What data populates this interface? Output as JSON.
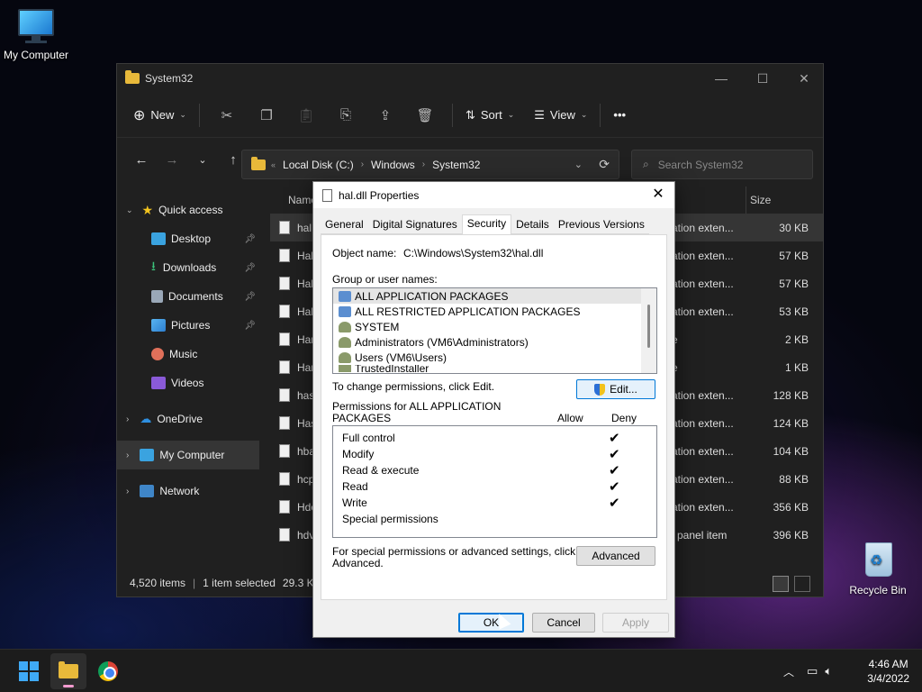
{
  "desktop": {
    "icons": [
      {
        "label": "My Computer"
      },
      {
        "label": "Recycle Bin"
      }
    ]
  },
  "explorer": {
    "title": "System32",
    "toolbar": {
      "new_label": "New",
      "sort_label": "Sort",
      "view_label": "View",
      "more_label": "•••"
    },
    "address": {
      "crumbs": [
        "Local Disk (C:)",
        "Windows",
        "System32"
      ],
      "search_placeholder": "Search System32"
    },
    "sidebar": {
      "items": [
        {
          "label": "Quick access"
        },
        {
          "label": "Desktop"
        },
        {
          "label": "Downloads"
        },
        {
          "label": "Documents"
        },
        {
          "label": "Pictures"
        },
        {
          "label": "Music"
        },
        {
          "label": "Videos"
        },
        {
          "label": "OneDrive"
        },
        {
          "label": "My Computer"
        },
        {
          "label": "Network"
        }
      ]
    },
    "columns": {
      "name": "Name",
      "size": "Size"
    },
    "files": [
      {
        "name": "hal.",
        "type": "ation exten...",
        "size": "30 KB"
      },
      {
        "name": "Hal",
        "type": "ation exten...",
        "size": "57 KB"
      },
      {
        "name": "Hal",
        "type": "ation exten...",
        "size": "57 KB"
      },
      {
        "name": "Hal",
        "type": "ation exten...",
        "size": "53 KB"
      },
      {
        "name": "Han",
        "type": "e",
        "size": "2 KB"
      },
      {
        "name": "Han",
        "type": "e",
        "size": "1 KB"
      },
      {
        "name": "has",
        "type": "ation exten...",
        "size": "128 KB"
      },
      {
        "name": "Has",
        "type": "ation exten...",
        "size": "124 KB"
      },
      {
        "name": "hba",
        "type": "ation exten...",
        "size": "104 KB"
      },
      {
        "name": "hcp",
        "type": "ation exten...",
        "size": "88 KB"
      },
      {
        "name": "Hdc",
        "type": "ation exten...",
        "size": "356 KB"
      },
      {
        "name": "hdv",
        "type": "l panel item",
        "size": "396 KB"
      }
    ],
    "status": {
      "items": "4,520 items",
      "selected": "1 item selected",
      "size": "29.3 KB"
    }
  },
  "dialog": {
    "title": "hal.dll Properties",
    "tabs": [
      "General",
      "Digital Signatures",
      "Security",
      "Details",
      "Previous Versions"
    ],
    "object_label": "Object name:",
    "object_value": "C:\\Windows\\System32\\hal.dll",
    "group_label": "Group or user names:",
    "users": [
      "ALL APPLICATION PACKAGES",
      "ALL RESTRICTED APPLICATION PACKAGES",
      "SYSTEM",
      "Administrators (VM6\\Administrators)",
      "Users (VM6\\Users)",
      "TrustedInstaller"
    ],
    "change_text": "To change permissions, click Edit.",
    "edit_label": "Edit...",
    "perm_header_line1": "Permissions for ALL APPLICATION",
    "perm_header_line2": "PACKAGES",
    "allow_label": "Allow",
    "deny_label": "Deny",
    "permissions": [
      {
        "name": "Full control",
        "deny": "✔"
      },
      {
        "name": "Modify",
        "deny": "✔"
      },
      {
        "name": "Read & execute",
        "deny": "✔"
      },
      {
        "name": "Read",
        "deny": "✔"
      },
      {
        "name": "Write",
        "deny": "✔"
      },
      {
        "name": "Special permissions",
        "deny": ""
      }
    ],
    "special_line1": "For special permissions or advanced settings, click",
    "special_line2": "Advanced.",
    "advanced_label": "Advanced",
    "ok_label": "OK",
    "cancel_label": "Cancel",
    "apply_label": "Apply"
  },
  "taskbar": {
    "time": "4:46 AM",
    "date": "3/4/2022"
  },
  "colors": {
    "accent": "#0078d7",
    "folder": "#e8b93a",
    "start": "#3fa9f5"
  }
}
